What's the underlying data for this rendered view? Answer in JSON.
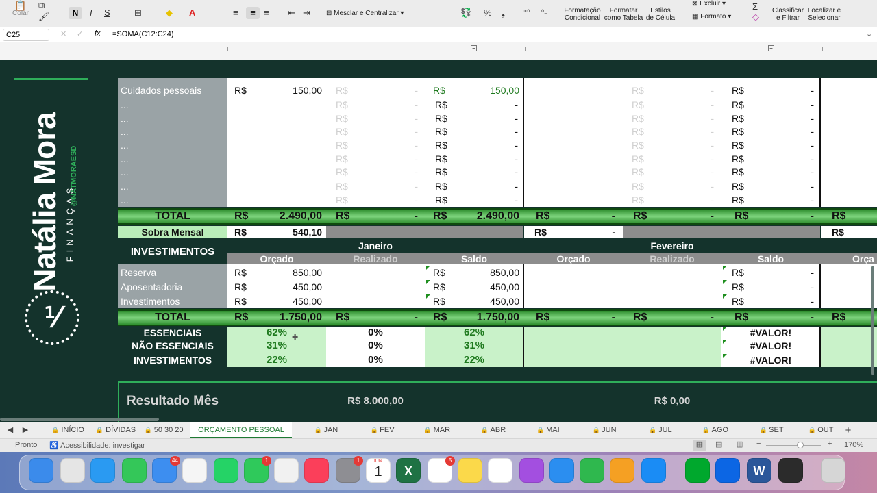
{
  "ribbon": {
    "colar": "Colar",
    "bold": "N",
    "italic": "I",
    "underline": "S",
    "merge": "Mesclar e Centralizar",
    "pct": "%",
    "comma": "❟",
    "cond1": "Formatação",
    "cond2": "Condicional",
    "ftab1": "Formatar",
    "ftab2": "como Tabela",
    "est1": "Estilos",
    "est2": "de Célula",
    "excluir": "Excluir",
    "formato": "Formato",
    "sort1": "Classificar",
    "sort2": "e Filtrar",
    "find1": "Localizar e",
    "find2": "Selecionar"
  },
  "formula": {
    "ref": "C25",
    "fx": "fx",
    "value": "=SOMA(C12:C24)"
  },
  "brand": {
    "name": "Natália Mora",
    "sub": "FINANÇAS",
    "handle": "@NATMORAESD"
  },
  "rows": {
    "cuidados": {
      "label": "Cuidados pessoais",
      "cur": "R$",
      "orcado": "150,00",
      "real_cur": "R$",
      "real": "-",
      "saldo_cur": "R$",
      "saldo": "150,00",
      "fev_real_cur": "R$",
      "fev_real": "-",
      "fev_saldo_cur": "R$",
      "fev_saldo": "-"
    },
    "dots": [
      "...",
      "...",
      "...",
      "...",
      "...",
      "...",
      "...",
      "..."
    ],
    "cur": "R$",
    "dash": "-"
  },
  "total1": {
    "label": "TOTAL",
    "c1": "R$",
    "v1": "2.490,00",
    "c2": "R$",
    "v2": "-",
    "c3": "R$",
    "v3": "2.490,00",
    "c4": "R$",
    "v4": "-",
    "c5": "R$",
    "v5": "-",
    "c6": "R$",
    "v6": "-",
    "c7": "R$"
  },
  "sobra": {
    "label": "Sobra Mensal",
    "cur": "R$",
    "value": "540,10",
    "fev_cur": "R$",
    "fev_value": "-",
    "mar_cur": "R$"
  },
  "investimentos": {
    "title": "INVESTIMENTOS",
    "jan": "Janeiro",
    "fev": "Fevereiro",
    "orcado": "Orçado",
    "realizado": "Realizado",
    "saldo": "Saldo",
    "orcado_fev": "Orçado",
    "realizado_fev": "Realizado",
    "saldo_fev": "Saldo",
    "orcado_mar": "Orça",
    "items": [
      {
        "label": "Reserva",
        "cur": "R$",
        "orcado": "850,00",
        "saldo_cur": "R$",
        "saldo": "850,00",
        "fev_cur": "R$",
        "fev": "-"
      },
      {
        "label": "Aposentadoria",
        "cur": "R$",
        "orcado": "450,00",
        "saldo_cur": "R$",
        "saldo": "450,00",
        "fev_cur": "R$",
        "fev": "-"
      },
      {
        "label": "Investimentos",
        "cur": "R$",
        "orcado": "450,00",
        "saldo_cur": "R$",
        "saldo": "450,00",
        "fev_cur": "R$",
        "fev": "-"
      }
    ]
  },
  "total2": {
    "label": "TOTAL",
    "c1": "R$",
    "v1": "1.750,00",
    "c2": "R$",
    "v2": "-",
    "c3": "R$",
    "v3": "1.750,00",
    "c4": "R$",
    "v4": "-",
    "c5": "R$",
    "v5": "-",
    "c6": "R$",
    "v6": "-",
    "c7": "R$"
  },
  "pct": [
    {
      "label": "ESSENCIAIS",
      "o": "62%",
      "r": "0%",
      "s": "62%",
      "fev": "#VALOR!"
    },
    {
      "label": "NÃO ESSENCIAIS",
      "o": "31%",
      "r": "0%",
      "s": "31%",
      "fev": "#VALOR!"
    },
    {
      "label": "INVESTIMENTOS",
      "o": "22%",
      "r": "0%",
      "s": "22%",
      "fev": "#VALOR!"
    }
  ],
  "resultado": {
    "label": "Resultado Mês",
    "jan": "R$ 8.000,00",
    "fev": "R$ 0,00"
  },
  "tabs": [
    "INÍCIO",
    "DÍVIDAS",
    "50 30 20",
    "ORÇAMENTO PESSOAL",
    "JAN",
    "FEV",
    "MAR",
    "ABR",
    "MAI",
    "JUN",
    "JUL",
    "AGO",
    "SET",
    "OUT"
  ],
  "active_tab": "ORÇAMENTO PESSOAL",
  "status": {
    "ready": "Pronto",
    "access": "Acessibilidade: investigar",
    "zoom": "170%"
  },
  "dock": {
    "mail_badge": "44",
    "facetime_badge": "1",
    "prefs_badge": "1",
    "reminders_badge": "5",
    "cal_month": "JUN.",
    "cal_day": "1"
  },
  "colors": {
    "dark": "#14332c",
    "green": "#1f7a1f",
    "light_green": "#c9f2c9",
    "gray_col": "#9aa3a6"
  }
}
